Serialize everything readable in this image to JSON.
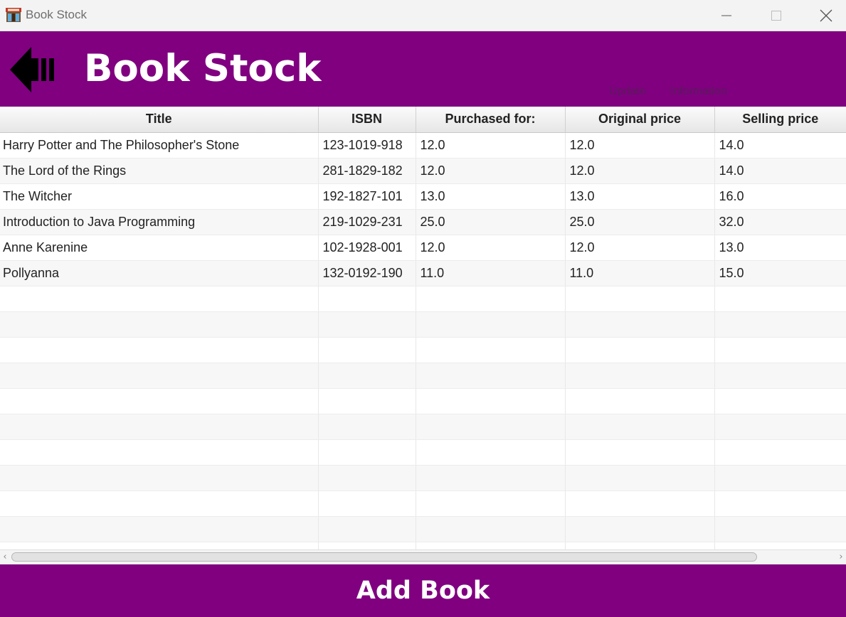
{
  "window": {
    "title": "Book Stock",
    "app_icon": "bookstore-icon",
    "controls": [
      "minimize-icon",
      "maximize-icon",
      "close-icon"
    ]
  },
  "header": {
    "back_icon": "back-arrow-icon",
    "title": "Book Stock",
    "links": {
      "update": "Update",
      "information": "Information"
    },
    "background_color": "#800080"
  },
  "table": {
    "columns": [
      "Title",
      "ISBN",
      "Purchased for:",
      "Original price",
      "Selling price"
    ],
    "rows": [
      [
        "Harry Potter and The Philosopher's Stone",
        "123-1019-918",
        "12.0",
        "12.0",
        "14.0"
      ],
      [
        "The Lord of the Rings",
        "281-1829-182",
        "12.0",
        "12.0",
        "14.0"
      ],
      [
        "The Witcher",
        "192-1827-101",
        "13.0",
        "13.0",
        "16.0"
      ],
      [
        "Introduction to Java Programming",
        "219-1029-231",
        "25.0",
        "25.0",
        "32.0"
      ],
      [
        "Anne Karenine",
        "102-1928-001",
        "12.0",
        "12.0",
        "13.0"
      ],
      [
        "Pollyanna",
        "132-0192-190",
        "11.0",
        "11.0",
        "15.0"
      ]
    ],
    "empty_rows": 11
  },
  "scrollbar": {
    "left_glyph": "‹",
    "right_glyph": "›"
  },
  "footer": {
    "add_button_label": "Add Book",
    "background_color": "#800080"
  }
}
